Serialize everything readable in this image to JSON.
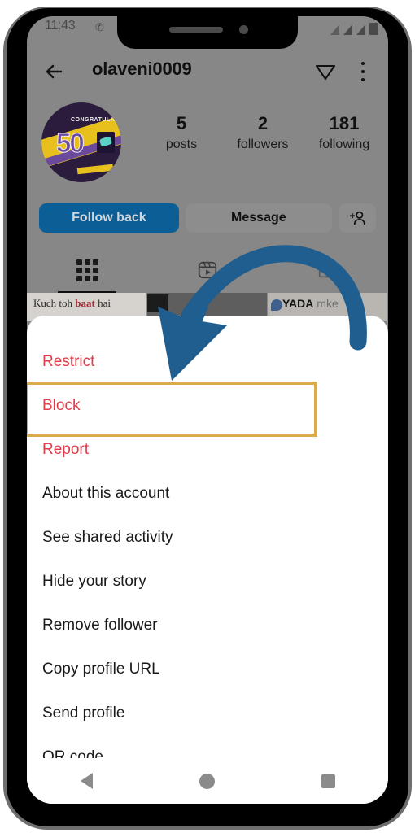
{
  "device": {
    "platform": "android-phone",
    "nav": {
      "back": "back-triangle",
      "home": "home-circle",
      "recents": "recents-square"
    }
  },
  "status_bar": {
    "time": "11:43",
    "call_icon": "phone-call-icon",
    "signal_icon": "signal-bars-icon",
    "battery_icon": "battery-icon"
  },
  "header": {
    "back_icon": "back-arrow-icon",
    "username": "olaveni0009",
    "share_icon": "paper-plane-icon",
    "menu_icon": "kebab-menu-icon"
  },
  "profile": {
    "avatar": {
      "alt": "congratulations-50-badge",
      "badge_text": "CONGRATULA",
      "number": "50"
    },
    "stats": [
      {
        "number": "5",
        "label": "posts"
      },
      {
        "number": "2",
        "label": "followers"
      },
      {
        "number": "181",
        "label": "following"
      }
    ],
    "actions": {
      "follow_back": "Follow back",
      "message": "Message",
      "add_user_icon": "add-person-icon"
    },
    "accent_blue": "#0b5e96"
  },
  "tabs": [
    {
      "name": "grid",
      "icon": "grid-icon",
      "active": true
    },
    {
      "name": "reels",
      "icon": "reels-icon",
      "active": false
    },
    {
      "name": "tagged",
      "icon": "tagged-photo-icon",
      "active": false
    }
  ],
  "posts_preview": [
    {
      "caption": "Kuch toh ",
      "caption_accent": "baat",
      "caption_tail": " hai"
    },
    {
      "caption": ""
    },
    {
      "caption": "YADA",
      "caption_tail": " mke"
    }
  ],
  "bottom_sheet": {
    "handle": "drag-handle",
    "items": [
      {
        "label": "Restrict",
        "danger": true
      },
      {
        "label": "Block",
        "danger": true
      },
      {
        "label": "Report",
        "danger": true
      },
      {
        "label": "About this account",
        "danger": false
      },
      {
        "label": "See shared activity",
        "danger": false
      },
      {
        "label": "Hide your story",
        "danger": false
      },
      {
        "label": "Remove follower",
        "danger": false
      },
      {
        "label": "Copy profile URL",
        "danger": false
      },
      {
        "label": "Send profile",
        "danger": false
      },
      {
        "label": "QR code",
        "danger": false
      }
    ],
    "danger_color": "#e23b4a"
  },
  "annotation": {
    "highlight_target": "Block",
    "highlight_color": "#d8a83f",
    "arrow_color": "#1f5e8f",
    "arrow_shape": "curved-arrow-pointing-down-left"
  }
}
